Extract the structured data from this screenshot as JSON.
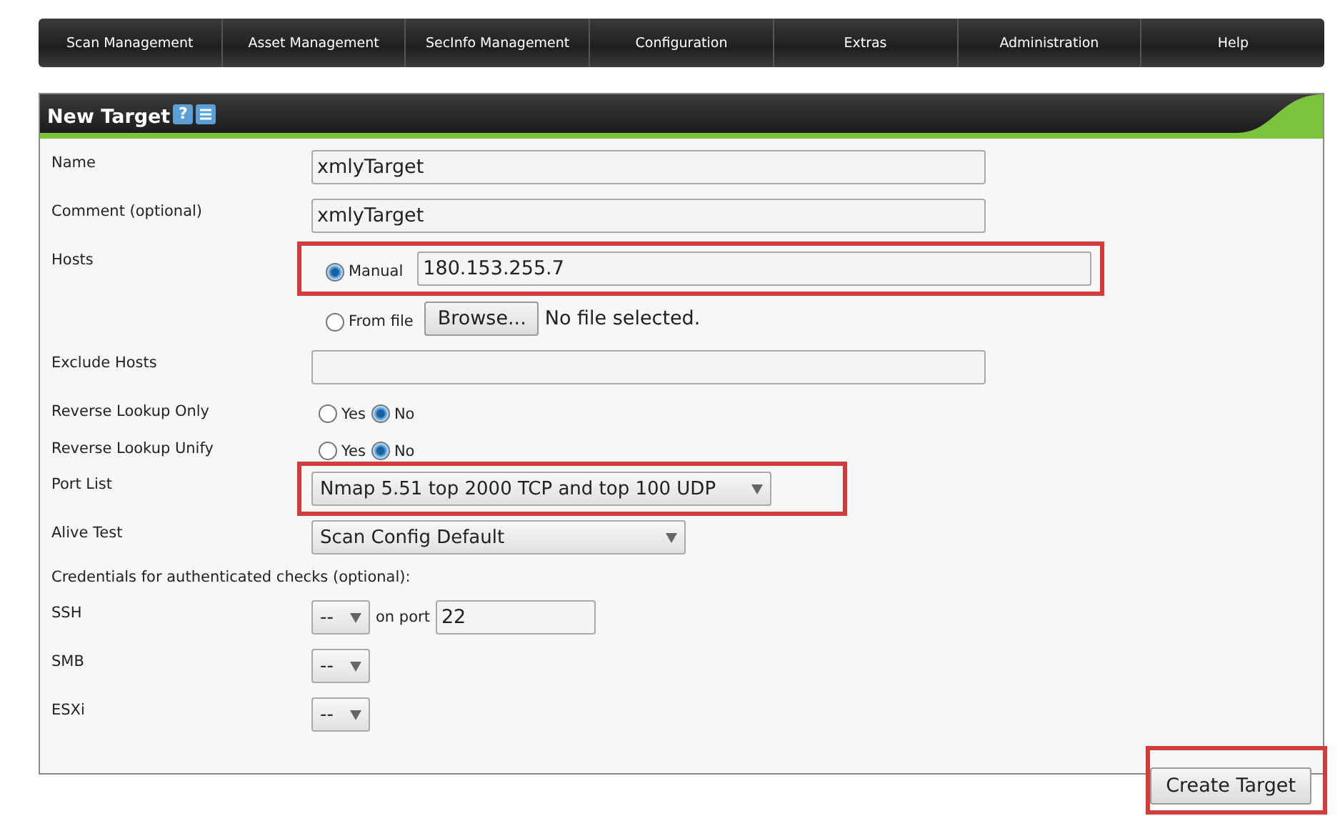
{
  "nav": [
    {
      "label": "Scan Management"
    },
    {
      "label": "Asset Management"
    },
    {
      "label": "SecInfo Management"
    },
    {
      "label": "Configuration"
    },
    {
      "label": "Extras"
    },
    {
      "label": "Administration"
    },
    {
      "label": "Help"
    }
  ],
  "panel": {
    "title": "New Target",
    "help_icon": "?"
  },
  "rows": [
    {
      "kind": "text",
      "label": "Name",
      "value": "xmlyTarget"
    },
    {
      "kind": "text",
      "label": "Comment (optional)",
      "value": "xmlyTarget"
    },
    {
      "kind": "hosts",
      "label": "Hosts",
      "highlighted": true,
      "manual": {
        "label": "Manual",
        "selected": true,
        "value": "180.153.255.7"
      },
      "file": {
        "label": "From file",
        "selected": false,
        "button": "Browse...",
        "status": "No file selected."
      }
    },
    {
      "kind": "text",
      "label": "Exclude Hosts"
    },
    {
      "kind": "radio",
      "label": "Reverse Lookup Only",
      "options": [
        {
          "label": "Yes",
          "selected": false
        },
        {
          "label": "No",
          "selected": true
        }
      ]
    },
    {
      "kind": "radio",
      "label": "Reverse Lookup Unify",
      "options": [
        {
          "label": "Yes",
          "selected": false
        },
        {
          "label": "No",
          "selected": true
        }
      ]
    },
    {
      "kind": "select",
      "label": "Port List",
      "value": "Nmap 5.51 top 2000 TCP and top 100 UDP",
      "highlighted": true
    },
    {
      "kind": "select",
      "label": "Alive Test",
      "value": "Scan Config Default",
      "highlighted": false
    },
    {
      "kind": "heading",
      "text": "Credentials for authenticated checks (optional):"
    },
    {
      "kind": "credential",
      "label": "SSH",
      "value": "--",
      "port_label": "on port",
      "port": "22"
    },
    {
      "kind": "credential",
      "label": "SMB",
      "value": "--"
    },
    {
      "kind": "credential",
      "label": "ESXi",
      "value": "--"
    }
  ],
  "submit": {
    "label": "Create Target",
    "highlighted": true
  }
}
